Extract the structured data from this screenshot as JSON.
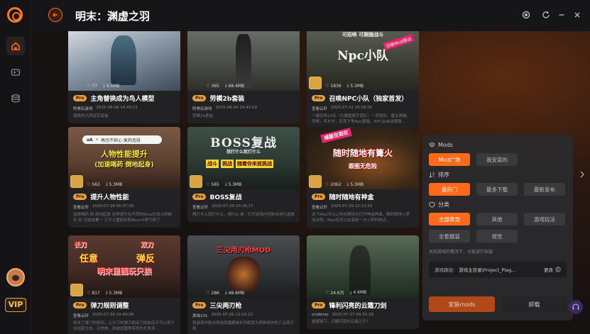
{
  "app": {
    "title": "明末：渊虚之羽",
    "vip_label": "VIP"
  },
  "cards": [
    {
      "title": "主角替换成为鸟人模型",
      "badge": "Pro",
      "author": "阿美玩游戏",
      "date": "2025-08-08 14:43:21",
      "desc": "替换的大西部军套装",
      "likes": "77",
      "size": "4.0MB"
    },
    {
      "title": "劳模2b套装",
      "badge": "Pro",
      "author": "阿美玩游戏",
      "date": "2025-08-04 19:43:19",
      "desc": "劳模2b套装",
      "likes": "365",
      "size": "68.4MB"
    },
    {
      "title": "召唤NPC小队（独家首发）",
      "badge": "Pro",
      "author": "查看云轩",
      "date": "2025-07-22 15:58:05",
      "desc": "一键召唤10名（大镰盘旗手团队）一同冒险，雷炎骑喵，狩帮，年岁岁，实现子等Npc跟随，NPC会自动跟随...",
      "likes": "1836",
      "size": "5.3MB",
      "overlay_top": "可招唤 可跟随战斗",
      "overlay_main": "Npc小队",
      "overlay_tag": "召唤Mod首出"
    },
    {
      "title": "提升人物性能",
      "badge": "Pro",
      "author": "查看云轩",
      "date": "2025-07-28 00:07:35",
      "desc": "加速喝药 和 倒地起身 这样提升在不同的Boss的战斗机制化 和 狂能拖累一 又可以重新的和Boss卡频亏损了",
      "likes": "563",
      "size": "5.3MB",
      "search_text": "再也不担心 疯狗连段",
      "overlay_main": "人物性能提升",
      "overlay_sub": "(加速喝药 倒地起身)"
    },
    {
      "title": "BOSS复战",
      "badge": "Pro",
      "author": "查看云轩",
      "date": "2025-07-29 10:29:17",
      "desc": "想打什么就打什么，按F10 或 - 打开游戏内控制台进行选择",
      "likes": "565",
      "size": "5.3MB",
      "overlay_main": "BOSS复战",
      "overlay_sub": "想打什么就打什么",
      "overlay_tags": [
        "战斗",
        "挑战",
        "随着你来就挑战"
      ]
    },
    {
      "title": "随时随地有神盒",
      "badge": "Pro",
      "author": "查看云轩",
      "date": "2025-07-26 12:12:53",
      "desc": "这个Mod可以让你在随地方打开神盒界面，随时随地入梦 加点呀，Mod也可以在每前一次入梦的地点...",
      "likes": "2062",
      "size": "5.3MB",
      "overlay_top": "城版在现在",
      "overlay_main": "随时随地有篝火",
      "overlay_sub": "跟图无危险"
    },
    {
      "title": "弹刀规则调整",
      "badge": "Pro",
      "author": "查看云轩",
      "date": "2025-07-30 10:49:09",
      "desc": "修改了弹刀的规则，让长刀的弹刀和双刀的前后不可以用于对远距生效。对举物，即被武器等带型的任务流...",
      "likes": "817",
      "size": "5.3MB",
      "overlay_tags": [
        "长刀",
        "双刀",
        "任意",
        "弹反"
      ],
      "overlay_main": "明末里面玩只狼"
    },
    {
      "title": "三尖两刃枪",
      "badge": "Pro",
      "author": "真域101",
      "date": "2025-07-26 12:16:22",
      "desc": "将游戏中除去原始剑偏鹿城长剑修改为两种状的的三尖两刃枪",
      "likes": "286",
      "size": "48.6MB",
      "overlay_main": "三尖两刃枪MOD"
    },
    {
      "title": "锋利闪亮的云霜刀剑",
      "badge": "Pro",
      "author": "cruibinio",
      "date": "2025-07-27 04:31:39",
      "desc": "超硬锋刀，闪耀闪亮的云霜之刃！",
      "likes": "24.6万",
      "size": "4.6MB"
    }
  ],
  "panel": {
    "mods_header": "Mods",
    "mods_tabs": [
      "Mod广场",
      "我安装的"
    ],
    "sort_header": "排序",
    "sort_tabs": [
      "最热门",
      "最多下载",
      "最新发布"
    ],
    "cat_header": "分类",
    "cat_tabs_row1": [
      "全部类型",
      "其他",
      "游戏玩法"
    ],
    "cat_tabs_row2": [
      "全套服装",
      "视觉"
    ],
    "hint": "关闭游戏的情况下，才能进行安装",
    "path_label": "游戏路径:",
    "path_value": "游戏主目录\\Project_Plag...",
    "path_change": "更改",
    "install_label": "安装mods",
    "uninstall_label": "卸载"
  },
  "colors": {
    "accent": "#ff6a1a",
    "pro_badge": "#e8a03a",
    "vip_gold": "#f5c65a"
  }
}
